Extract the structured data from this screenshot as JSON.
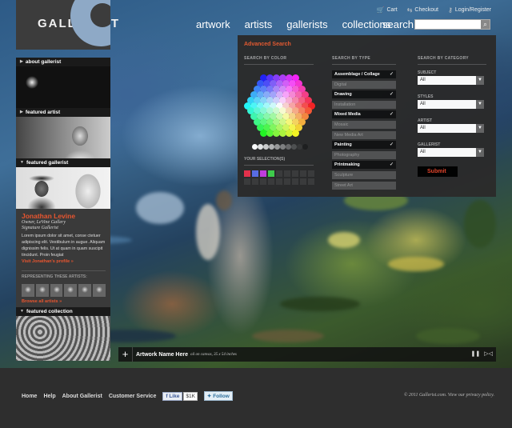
{
  "brand": {
    "name": "GALLERIST"
  },
  "utility": [
    {
      "label": "Cart",
      "icon": "cart-icon"
    },
    {
      "label": "Checkout",
      "icon": "checkout-icon"
    },
    {
      "label": "Login/Register",
      "icon": "key-icon"
    }
  ],
  "nav": [
    "artwork",
    "artists",
    "gallerists",
    "collections"
  ],
  "search": {
    "label": "search:",
    "value": ""
  },
  "advanced_search": {
    "title": "Advanced Search",
    "color_heading": "SEARCH BY COLOR",
    "type_heading": "SEARCH BY TYPE",
    "category_heading": "SEARCH BY  CATEGORY",
    "selections_heading": "YOUR SELECTION(S)",
    "selected_colors": [
      "#e8304a",
      "#5a6de8",
      "#c43de0",
      "#3fcf4a"
    ],
    "types": [
      {
        "label": "Assemblage / Collage",
        "selected": true
      },
      {
        "label": "Digital",
        "selected": false
      },
      {
        "label": "Drawing",
        "selected": true
      },
      {
        "label": "Installation",
        "selected": false
      },
      {
        "label": "Mixed Media",
        "selected": true
      },
      {
        "label": "Mosaic",
        "selected": false
      },
      {
        "label": "New Media Art",
        "selected": false
      },
      {
        "label": "Painting",
        "selected": true
      },
      {
        "label": "Photography",
        "selected": false
      },
      {
        "label": "Printmaking",
        "selected": true
      },
      {
        "label": "Sculpture",
        "selected": false
      },
      {
        "label": "Street Art",
        "selected": false
      }
    ],
    "categories": [
      {
        "label": "SUBJECT",
        "value": "All"
      },
      {
        "label": "STYLES",
        "value": "All"
      },
      {
        "label": "ARTIST",
        "value": "All"
      },
      {
        "label": "GALLERIST",
        "value": "All"
      }
    ],
    "submit_label": "Submit"
  },
  "sidebar": {
    "about_label": "about gallerist",
    "featured_artist_label": "featured artist",
    "featured_gallerist_label": "featured gallerist",
    "gallerist": {
      "name": "Jonathan Levine",
      "role": "Owner, LeVine Gallery",
      "badge": "Signature Gallerist",
      "description": "Lorem ipsum dolor sit amet, conse ctetuer adipiscing elit. Vestibulum in augue. Aliquam dignissim felis. Ut at quam in quam suscipit tincidunt. Proin feugiat",
      "visit_link": "Visit Jonathan's profile »",
      "representing_label": "REPRESENTING THESE ARTISTS:",
      "browse_link": "Browse all artists »"
    },
    "featured_collection_label": "featured collection"
  },
  "caption": {
    "artwork_name": "Artwork Name Here",
    "meta": "oil on canvas, 35 x 54 inches"
  },
  "footer": {
    "links": [
      "Home",
      "Help",
      "About Gallerist",
      "Customer Service"
    ],
    "like_label": "Like",
    "like_count": "$1K",
    "follow_label": "Follow",
    "copyright": "© 2011 Gallerist.com. View our privacy policy."
  }
}
